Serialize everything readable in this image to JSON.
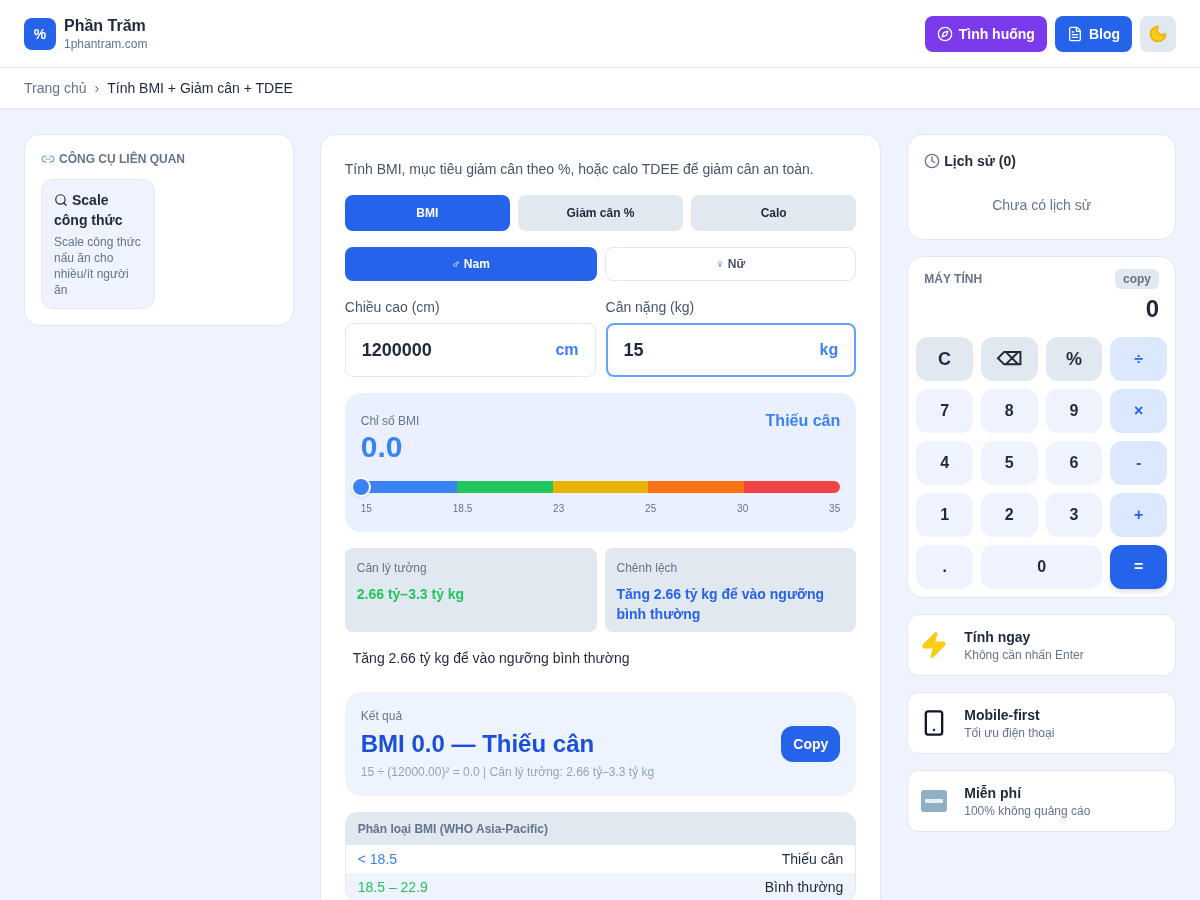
{
  "header": {
    "logo": "%",
    "title": "Phần Trăm",
    "domain": "1phantram.com",
    "buttons": [
      {
        "kind": "compass",
        "label": "Tình huống",
        "color": "#7c3aed"
      },
      {
        "kind": "memo",
        "label": "Blog",
        "color": "#2563eb"
      }
    ]
  },
  "breadcrumb": {
    "home": "Trang chủ",
    "separator": "›",
    "current": "Tính BMI + Giảm cân + TDEE"
  },
  "related": {
    "title": "CÔNG CỤ LIÊN QUAN",
    "items": [
      {
        "title": "Scale công thức",
        "description": "Scale công thức nấu ăn cho nhiều/ít người ăn"
      }
    ]
  },
  "calculator": {
    "intro": "Tính BMI, mục tiêu giảm cân theo %, hoặc calo TDEE để giảm cân an toàn.",
    "modes": [
      {
        "label": "BMI",
        "selected": true
      },
      {
        "label": "Giảm cân %",
        "selected": false
      },
      {
        "label": "Calo",
        "selected": false
      }
    ],
    "genders": [
      {
        "label": "♂ Nam",
        "selected": true
      },
      {
        "label": "♀ Nữ",
        "selected": false
      }
    ],
    "fields": [
      {
        "label": "Chiều cao (cm)",
        "value": "1200000",
        "unit": "cm",
        "focused": false
      },
      {
        "label": "Cân nặng (kg)",
        "value": "15",
        "unit": "kg",
        "focused": true
      }
    ],
    "gauge": {
      "label": "Chỉ số BMI",
      "value": "0.0",
      "category": "Thiếu cân",
      "level": 0,
      "ticks": [
        "15",
        "18.5",
        "23",
        "25",
        "30",
        "35"
      ]
    },
    "stats": [
      {
        "label": "Cân lý tưởng",
        "value": "2.66 tỷ–3.3 tỷ kg",
        "color": "#22c55e"
      },
      {
        "label": "Chênh lệch",
        "value": "Tăng 2.66 tỷ kg để vào ngưỡng bình thường",
        "color": "#2563eb"
      }
    ],
    "note": "Tăng 2.66 tỷ kg để vào ngưỡng bình thường",
    "result": {
      "label": "Kết quả",
      "value": "BMI 0.0 — Thiếu cân",
      "formula": "15 ÷ (12000.00)² = 0.0 | Cân lý tưởng: 2.66 tỷ–3.3 tỷ kg",
      "button": "Copy"
    },
    "table": {
      "title": "Phân loại BMI (WHO Asia-Pacific)",
      "rows": [
        {
          "range": "< 18.5",
          "category": "Thiếu cân",
          "color": "#3b82f6"
        },
        {
          "range": "18.5 – 22.9",
          "category": "Bình thường",
          "color": "#22c55e"
        }
      ]
    }
  },
  "history": {
    "title": "Lịch sử (0)",
    "empty": "Chưa có lịch sử"
  },
  "mini_calc": {
    "title": "MÁY TÍNH",
    "copy": "copy",
    "display": "0",
    "keys": [
      {
        "label": "C",
        "kind": "func"
      },
      {
        "label": "⌫",
        "kind": "func"
      },
      {
        "label": "%",
        "kind": "func"
      },
      {
        "label": "÷",
        "kind": "op"
      },
      {
        "label": "7",
        "kind": "num"
      },
      {
        "label": "8",
        "kind": "num"
      },
      {
        "label": "9",
        "kind": "num"
      },
      {
        "label": "×",
        "kind": "op"
      },
      {
        "label": "4",
        "kind": "num"
      },
      {
        "label": "5",
        "kind": "num"
      },
      {
        "label": "6",
        "kind": "num"
      },
      {
        "label": "-",
        "kind": "op"
      },
      {
        "label": "1",
        "kind": "num"
      },
      {
        "label": "2",
        "kind": "num"
      },
      {
        "label": "3",
        "kind": "num"
      },
      {
        "label": "+",
        "kind": "op"
      },
      {
        "label": ".",
        "kind": "num"
      },
      {
        "label": "0",
        "kind": "wide"
      },
      {
        "label": "=",
        "kind": "equals"
      }
    ]
  },
  "features": [
    {
      "kind": "bolt",
      "title": "Tính ngay",
      "subtitle": "Không cần nhấn Enter"
    },
    {
      "kind": "phone",
      "title": "Mobile-first",
      "subtitle": "Tối ưu điện thoại"
    },
    {
      "kind": "free",
      "title": "Miễn phí",
      "subtitle": "100% không quảng cáo"
    }
  ]
}
